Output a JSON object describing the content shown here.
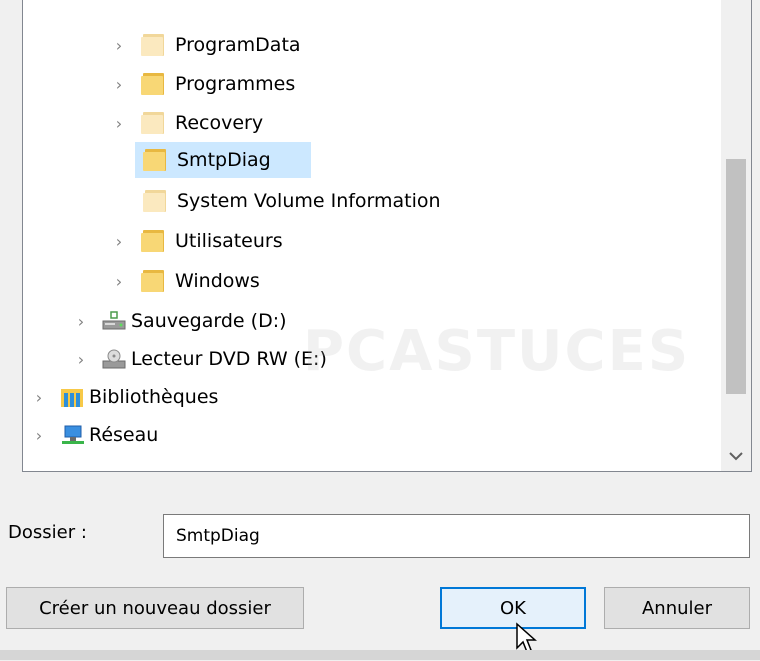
{
  "tree": {
    "items": [
      {
        "label": "ProgramData",
        "chevron": "›",
        "icon": "folder-icon",
        "shade": "light"
      },
      {
        "label": "Programmes",
        "chevron": "›",
        "icon": "folder-icon",
        "shade": "normal"
      },
      {
        "label": "Recovery",
        "chevron": "›",
        "icon": "folder-icon",
        "shade": "light"
      },
      {
        "label": "SmtpDiag",
        "chevron": "",
        "icon": "folder-icon",
        "shade": "normal",
        "selected": true
      },
      {
        "label": "System Volume Information",
        "chevron": "",
        "icon": "folder-icon",
        "shade": "light"
      },
      {
        "label": "Utilisateurs",
        "chevron": "›",
        "icon": "folder-icon",
        "shade": "normal"
      },
      {
        "label": "Windows",
        "chevron": "›",
        "icon": "folder-icon",
        "shade": "normal"
      },
      {
        "label": "Sauvegarde (D:)",
        "chevron": "›",
        "icon": "drive-icon"
      },
      {
        "label": "Lecteur DVD RW (E:)",
        "chevron": "›",
        "icon": "dvd-drive-icon"
      },
      {
        "label": "Bibliothèques",
        "chevron": "›",
        "icon": "libraries-icon"
      },
      {
        "label": "Réseau",
        "chevron": "›",
        "icon": "network-icon"
      }
    ]
  },
  "watermark": "PCASTUCES",
  "folder_field": {
    "label": "Dossier :",
    "value": "SmtpDiag"
  },
  "buttons": {
    "new_folder": "Créer un nouveau dossier",
    "ok": "OK",
    "cancel": "Annuler"
  },
  "colors": {
    "selection": "#cce8ff",
    "accent": "#0078d7",
    "folder": "#f8d775"
  }
}
